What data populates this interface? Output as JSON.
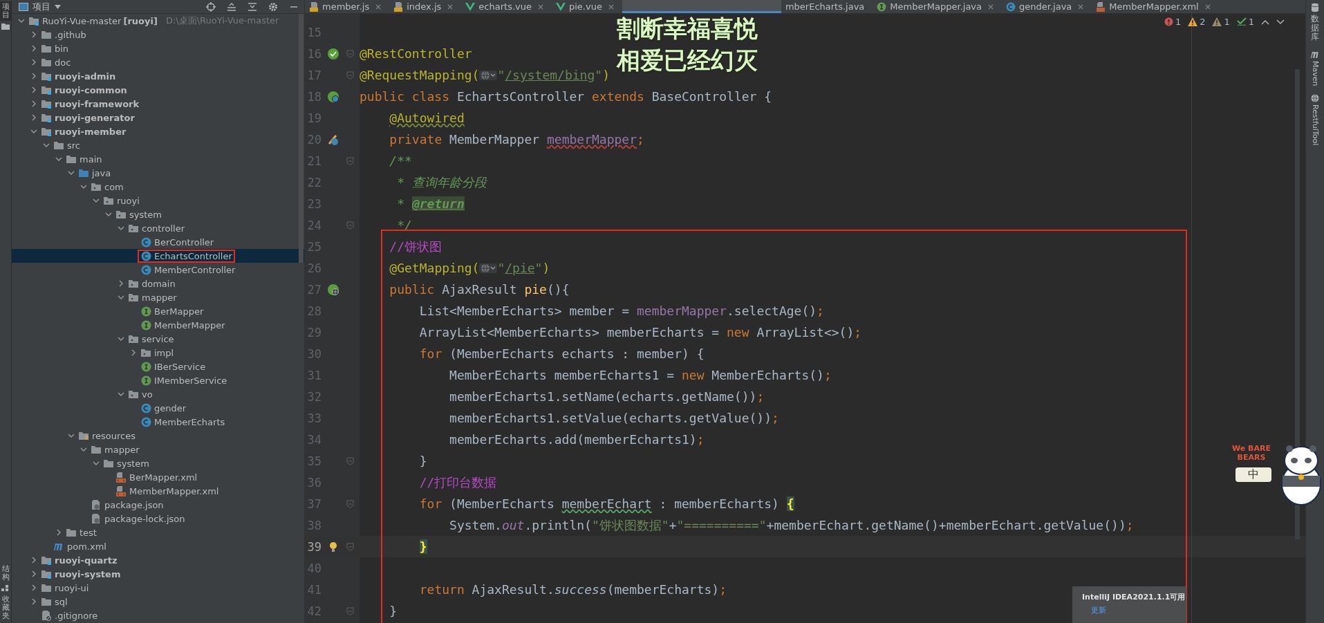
{
  "left_strip": {
    "top": [
      {
        "label": "项目",
        "selected": true
      }
    ],
    "bottom": [
      {
        "label": "结构",
        "selected": false
      },
      {
        "label": "收藏夹",
        "selected": false
      }
    ]
  },
  "project": {
    "title": "项目",
    "tree": [
      {
        "name": "RuoYi-Vue-master",
        "tag": "[ruoyi]",
        "path": "D:\\桌面\\RuoYi-Vue-master",
        "kind": "module",
        "expanded": true,
        "selected": false,
        "boxed": false,
        "children": [
          {
            "name": ".github",
            "kind": "folder",
            "expanded": false,
            "selected": false,
            "boxed": false
          },
          {
            "name": "bin",
            "kind": "folder",
            "expanded": false,
            "selected": false,
            "boxed": false
          },
          {
            "name": "doc",
            "kind": "folder",
            "expanded": false,
            "selected": false,
            "boxed": false
          },
          {
            "name": "ruoyi-admin",
            "kind": "module",
            "expanded": false,
            "selected": false,
            "boxed": false
          },
          {
            "name": "ruoyi-common",
            "kind": "module",
            "expanded": false,
            "selected": false,
            "boxed": false
          },
          {
            "name": "ruoyi-framework",
            "kind": "module",
            "expanded": false,
            "selected": false,
            "boxed": false
          },
          {
            "name": "ruoyi-generator",
            "kind": "module",
            "expanded": false,
            "selected": false,
            "boxed": false
          },
          {
            "name": "ruoyi-member",
            "kind": "module",
            "expanded": true,
            "selected": false,
            "boxed": false,
            "children": [
              {
                "name": "src",
                "kind": "folder",
                "expanded": true,
                "selected": false,
                "boxed": false,
                "children": [
                  {
                    "name": "main",
                    "kind": "folder",
                    "expanded": true,
                    "selected": false,
                    "boxed": false,
                    "children": [
                      {
                        "name": "java",
                        "kind": "source",
                        "expanded": true,
                        "selected": false,
                        "boxed": false,
                        "children": [
                          {
                            "name": "com",
                            "kind": "package",
                            "expanded": true,
                            "selected": false,
                            "boxed": false,
                            "children": [
                              {
                                "name": "ruoyi",
                                "kind": "package",
                                "expanded": true,
                                "selected": false,
                                "boxed": false,
                                "children": [
                                  {
                                    "name": "system",
                                    "kind": "package",
                                    "expanded": true,
                                    "selected": false,
                                    "boxed": false,
                                    "children": [
                                      {
                                        "name": "controller",
                                        "kind": "package",
                                        "expanded": true,
                                        "selected": false,
                                        "boxed": false,
                                        "children": [
                                          {
                                            "name": "BerController",
                                            "kind": "class",
                                            "selected": false,
                                            "boxed": false
                                          },
                                          {
                                            "name": "EchartsController",
                                            "kind": "class",
                                            "selected": true,
                                            "boxed": true
                                          },
                                          {
                                            "name": "MemberController",
                                            "kind": "class",
                                            "selected": false,
                                            "boxed": false
                                          }
                                        ]
                                      },
                                      {
                                        "name": "domain",
                                        "kind": "package",
                                        "expanded": false,
                                        "selected": false,
                                        "boxed": false
                                      },
                                      {
                                        "name": "mapper",
                                        "kind": "package",
                                        "expanded": true,
                                        "selected": false,
                                        "boxed": false,
                                        "children": [
                                          {
                                            "name": "BerMapper",
                                            "kind": "interface",
                                            "selected": false,
                                            "boxed": false
                                          },
                                          {
                                            "name": "MemberMapper",
                                            "kind": "interface",
                                            "selected": false,
                                            "boxed": false
                                          }
                                        ]
                                      },
                                      {
                                        "name": "service",
                                        "kind": "package",
                                        "expanded": true,
                                        "selected": false,
                                        "boxed": false,
                                        "children": [
                                          {
                                            "name": "impl",
                                            "kind": "package",
                                            "expanded": false,
                                            "selected": false,
                                            "boxed": false
                                          },
                                          {
                                            "name": "IBerService",
                                            "kind": "interface",
                                            "selected": false,
                                            "boxed": false
                                          },
                                          {
                                            "name": "IMemberService",
                                            "kind": "interface",
                                            "selected": false,
                                            "boxed": false
                                          }
                                        ]
                                      },
                                      {
                                        "name": "vo",
                                        "kind": "package",
                                        "expanded": true,
                                        "selected": false,
                                        "boxed": false,
                                        "children": [
                                          {
                                            "name": "gender",
                                            "kind": "class",
                                            "selected": false,
                                            "boxed": false
                                          },
                                          {
                                            "name": "MemberEcharts",
                                            "kind": "class",
                                            "selected": false,
                                            "boxed": false
                                          }
                                        ]
                                      }
                                    ]
                                  }
                                ]
                              }
                            ]
                          }
                        ]
                      },
                      {
                        "name": "resources",
                        "kind": "resources",
                        "expanded": true,
                        "selected": false,
                        "boxed": false,
                        "children": [
                          {
                            "name": "mapper",
                            "kind": "folder",
                            "expanded": true,
                            "selected": false,
                            "boxed": false,
                            "children": [
                              {
                                "name": "system",
                                "kind": "folder",
                                "expanded": true,
                                "selected": false,
                                "boxed": false,
                                "children": [
                                  {
                                    "name": "BerMapper.xml",
                                    "kind": "xml",
                                    "selected": false,
                                    "boxed": false
                                  },
                                  {
                                    "name": "MemberMapper.xml",
                                    "kind": "xml",
                                    "selected": false,
                                    "boxed": false
                                  }
                                ]
                              }
                            ]
                          },
                          {
                            "name": "package.json",
                            "kind": "json",
                            "selected": false,
                            "boxed": false
                          },
                          {
                            "name": "package-lock.json",
                            "kind": "json",
                            "selected": false,
                            "boxed": false
                          }
                        ]
                      }
                    ]
                  },
                  {
                    "name": "test",
                    "kind": "folder",
                    "expanded": false,
                    "selected": false,
                    "boxed": false
                  }
                ]
              },
              {
                "name": "pom.xml",
                "kind": "maven",
                "selected": false,
                "boxed": false
              }
            ]
          },
          {
            "name": "ruoyi-quartz",
            "kind": "module",
            "expanded": false,
            "selected": false,
            "boxed": false
          },
          {
            "name": "ruoyi-system",
            "kind": "module",
            "expanded": false,
            "selected": false,
            "boxed": false
          },
          {
            "name": "ruoyi-ui",
            "kind": "folder",
            "expanded": false,
            "selected": false,
            "boxed": false
          },
          {
            "name": "sql",
            "kind": "folder",
            "expanded": false,
            "selected": false,
            "boxed": false
          },
          {
            "name": ".gitignore",
            "kind": "gitignore",
            "selected": false,
            "boxed": false
          }
        ]
      }
    ]
  },
  "tabs": [
    {
      "label": "member.js",
      "kind": "js",
      "selected": false
    },
    {
      "label": "index.js",
      "kind": "js",
      "selected": false
    },
    {
      "label": "echarts.vue",
      "kind": "vue",
      "selected": false
    },
    {
      "label": "pie.vue",
      "kind": "vue",
      "selected": false
    },
    {
      "kind": "covered",
      "selected": true
    },
    {
      "label": "mberEcharts.java",
      "kind": "clipped",
      "selected": false
    },
    {
      "label": "MemberMapper.java",
      "kind": "interface",
      "selected": false
    },
    {
      "label": "gender.java",
      "kind": "class",
      "selected": false
    },
    {
      "label": "MemberMapper.xml",
      "kind": "xml",
      "selected": false
    }
  ],
  "inspections": [
    {
      "kind": "error",
      "count": "1"
    },
    {
      "kind": "warning",
      "count": "2"
    },
    {
      "kind": "weak",
      "count": "1"
    },
    {
      "kind": "typo",
      "count": "1"
    }
  ],
  "code": [
    {
      "number": "15",
      "fold": false,
      "current": false
    },
    {
      "number": "16",
      "fold": true,
      "current": false,
      "kind": "bean",
      "tokens": [
        {
          "text": "@RestController",
          "kind": "annotation"
        }
      ]
    },
    {
      "number": "17",
      "fold": true,
      "current": false,
      "tokens": [
        {
          "text": "@RequestMapping(",
          "kind": "annotation"
        },
        {
          "kind": "globe"
        },
        {
          "text": "\"",
          "kind": "string"
        },
        {
          "text": "/system/bing",
          "kind": "url"
        },
        {
          "text": "\"",
          "kind": "string"
        },
        {
          "text": ")",
          "kind": "annotation"
        }
      ]
    },
    {
      "number": "18",
      "fold": false,
      "current": false,
      "kind": "class",
      "tokens": [
        {
          "text": "public class ",
          "kind": "keyword"
        },
        {
          "text": "EchartsController ",
          "kind": "plain"
        },
        {
          "text": "extends ",
          "kind": "keyword"
        },
        {
          "text": "BaseController {",
          "kind": "plain"
        }
      ]
    },
    {
      "number": "19",
      "fold": false,
      "current": false,
      "tokens": [
        {
          "text": "    @Autowired",
          "kind": "annotation_warn"
        }
      ]
    },
    {
      "number": "20",
      "fold": false,
      "current": false,
      "kind": "autowire",
      "tokens": [
        {
          "text": "    private ",
          "kind": "keyword"
        },
        {
          "text": "MemberMapper ",
          "kind": "plain"
        },
        {
          "text": "memberMapper",
          "kind": "field_error"
        },
        {
          "text": ";",
          "kind": "keyword"
        }
      ]
    },
    {
      "number": "21",
      "fold": true,
      "current": false,
      "tokens": [
        {
          "text": "    /**",
          "kind": "doc"
        }
      ]
    },
    {
      "number": "22",
      "fold": false,
      "current": false,
      "tokens": [
        {
          "text": "     * 查询年龄分段",
          "kind": "doc"
        }
      ]
    },
    {
      "number": "23",
      "fold": false,
      "current": false,
      "tokens": [
        {
          "text": "     * ",
          "kind": "doc"
        },
        {
          "text": "@return",
          "kind": "doctag"
        }
      ]
    },
    {
      "number": "24",
      "fold": true,
      "current": false,
      "tokens": [
        {
          "text": "     */",
          "kind": "doc"
        }
      ]
    },
    {
      "number": "25",
      "fold": false,
      "current": false,
      "tokens": [
        {
          "text": "    //饼状图",
          "kind": "comment"
        }
      ]
    },
    {
      "number": "26",
      "fold": false,
      "current": false,
      "tokens": [
        {
          "text": "    @GetMapping(",
          "kind": "annotation"
        },
        {
          "kind": "globe"
        },
        {
          "text": "\"",
          "kind": "string"
        },
        {
          "text": "/pie",
          "kind": "url"
        },
        {
          "text": "\"",
          "kind": "string"
        },
        {
          "text": ")",
          "kind": "annotation"
        }
      ]
    },
    {
      "number": "27",
      "fold": false,
      "current": false,
      "kind": "web",
      "tokens": [
        {
          "text": "    public ",
          "kind": "keyword"
        },
        {
          "text": "AjaxResult ",
          "kind": "plain"
        },
        {
          "text": "pie",
          "kind": "method"
        },
        {
          "text": "(){",
          "kind": "plain"
        }
      ]
    },
    {
      "number": "28",
      "fold": false,
      "current": false,
      "tokens": [
        {
          "text": "        List<MemberEcharts> member = ",
          "kind": "plain"
        },
        {
          "text": "memberMapper",
          "kind": "field"
        },
        {
          "text": ".selectAge()",
          "kind": "plain"
        },
        {
          "text": ";",
          "kind": "keyword"
        }
      ]
    },
    {
      "number": "29",
      "fold": false,
      "current": false,
      "tokens": [
        {
          "text": "        ArrayList<MemberEcharts> memberEcharts = ",
          "kind": "plain"
        },
        {
          "text": "new ",
          "kind": "keyword"
        },
        {
          "text": "ArrayList<>()",
          "kind": "plain"
        },
        {
          "text": ";",
          "kind": "keyword"
        }
      ]
    },
    {
      "number": "30",
      "fold": false,
      "current": false,
      "tokens": [
        {
          "text": "        for ",
          "kind": "keyword"
        },
        {
          "text": "(MemberEcharts echarts : member) {",
          "kind": "plain"
        }
      ]
    },
    {
      "number": "31",
      "fold": false,
      "current": false,
      "tokens": [
        {
          "text": "            MemberEcharts memberEcharts1 = ",
          "kind": "plain"
        },
        {
          "text": "new ",
          "kind": "keyword"
        },
        {
          "text": "MemberEcharts()",
          "kind": "plain"
        },
        {
          "text": ";",
          "kind": "keyword"
        }
      ]
    },
    {
      "number": "32",
      "fold": false,
      "current": false,
      "tokens": [
        {
          "text": "            memberEcharts1.setName(echarts.getName())",
          "kind": "plain"
        },
        {
          "text": ";",
          "kind": "keyword"
        }
      ]
    },
    {
      "number": "33",
      "fold": false,
      "current": false,
      "tokens": [
        {
          "text": "            memberEcharts1.setValue(echarts.getValue())",
          "kind": "plain"
        },
        {
          "text": ";",
          "kind": "keyword"
        }
      ]
    },
    {
      "number": "34",
      "fold": false,
      "current": false,
      "tokens": [
        {
          "text": "            memberEcharts.add(memberEcharts1)",
          "kind": "plain"
        },
        {
          "text": ";",
          "kind": "keyword"
        }
      ]
    },
    {
      "number": "35",
      "fold": true,
      "current": false,
      "tokens": [
        {
          "text": "        }",
          "kind": "plain"
        }
      ]
    },
    {
      "number": "36",
      "fold": false,
      "current": false,
      "tokens": [
        {
          "text": "        //打印台数据",
          "kind": "comment"
        }
      ]
    },
    {
      "number": "37",
      "fold": true,
      "current": false,
      "tokens": [
        {
          "text": "        for ",
          "kind": "keyword"
        },
        {
          "text": "(MemberEcharts ",
          "kind": "plain"
        },
        {
          "text": "memberEchart",
          "kind": "typo"
        },
        {
          "text": " : memberEcharts) ",
          "kind": "plain"
        },
        {
          "text": "{",
          "kind": "brace"
        }
      ]
    },
    {
      "number": "38",
      "fold": false,
      "current": false,
      "tokens": [
        {
          "text": "            System.",
          "kind": "plain"
        },
        {
          "text": "out",
          "kind": "static"
        },
        {
          "text": ".println(",
          "kind": "plain"
        },
        {
          "text": "\"饼状图数据\"",
          "kind": "string"
        },
        {
          "text": "+",
          "kind": "plain"
        },
        {
          "text": "\"==========\"",
          "kind": "string"
        },
        {
          "text": "+memberEchart.getName()+memberEchart.getValue())",
          "kind": "plain"
        },
        {
          "text": ";",
          "kind": "keyword"
        }
      ]
    },
    {
      "number": "39",
      "fold": true,
      "current": true,
      "kind": "bulb",
      "tokens": [
        {
          "text": "        }",
          "kind": "brace"
        }
      ]
    },
    {
      "number": "40",
      "fold": false,
      "current": false
    },
    {
      "number": "41",
      "fold": false,
      "current": false,
      "tokens": [
        {
          "text": "        return ",
          "kind": "keyword"
        },
        {
          "text": "AjaxResult.",
          "kind": "plain"
        },
        {
          "text": "success",
          "kind": "italic"
        },
        {
          "text": "(memberEcharts)",
          "kind": "plain"
        },
        {
          "text": ";",
          "kind": "keyword"
        }
      ]
    },
    {
      "number": "42",
      "fold": true,
      "current": false,
      "tokens": [
        {
          "text": "    }",
          "kind": "plain"
        }
      ]
    }
  ],
  "lyrics": [
    "割断幸福喜悦",
    "相爱已经幻灭"
  ],
  "ime": {
    "skin_title": "We BARE BEARS",
    "mode": "中"
  },
  "notification": {
    "title": "IntelliJ IDEA2021.1.1可用",
    "link": "更新"
  },
  "right_strip": [
    {
      "label": "数据库",
      "kind": "database"
    },
    {
      "label": "Maven",
      "kind": "maven"
    },
    {
      "label": "RestfulTool",
      "kind": "rest"
    }
  ],
  "code_annotation_box": true
}
